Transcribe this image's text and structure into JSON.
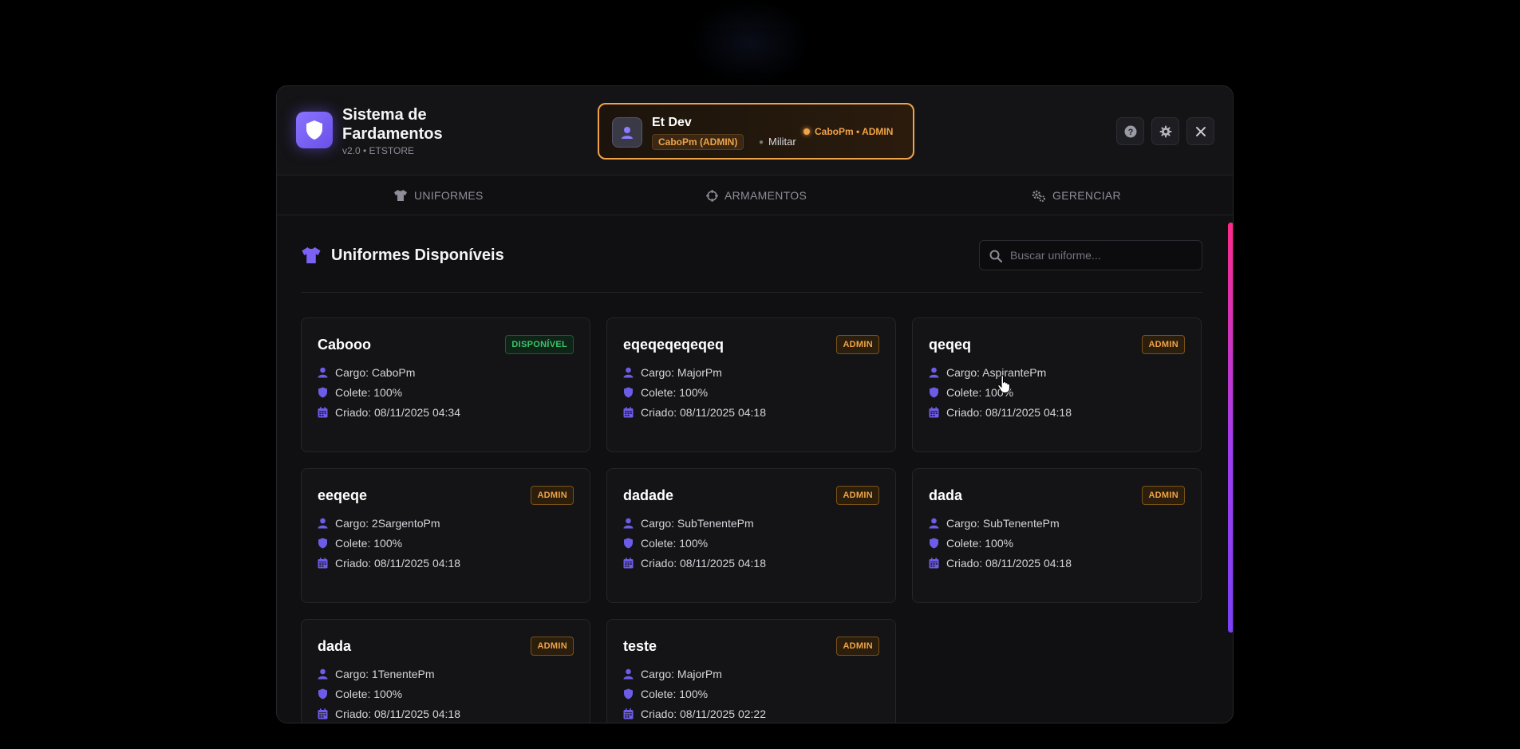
{
  "app": {
    "title": "Sistema de Fardamentos",
    "subtitle": "v2.0 • ETSTORE"
  },
  "user": {
    "name": "Et Dev",
    "rank": "CaboPm (ADMIN)",
    "role": "Militar",
    "status": "CaboPm • ADMIN"
  },
  "tabs": [
    {
      "label": "UNIFORMES",
      "icon": "shirt-icon",
      "active": true
    },
    {
      "label": "ARMAMENTOS",
      "icon": "crosshair-icon"
    },
    {
      "label": "GERENCIAR",
      "icon": "gears-icon"
    }
  ],
  "main": {
    "title": "Uniformes Disponíveis",
    "search_placeholder": "Buscar uniforme..."
  },
  "cards": [
    {
      "name": "Cabooo",
      "badge": "DISPONÍVEL",
      "badge_type": "ok",
      "cargo": "Cargo: CaboPm",
      "colete": "Colete: 100%",
      "criado": "Criado: 08/11/2025 04:34"
    },
    {
      "name": "eqeqeqeqeqeq",
      "badge": "ADMIN",
      "badge_type": "admin",
      "cargo": "Cargo: MajorPm",
      "colete": "Colete: 100%",
      "criado": "Criado: 08/11/2025 04:18"
    },
    {
      "name": "qeqeq",
      "badge": "ADMIN",
      "badge_type": "admin",
      "cargo": "Cargo: AspirantePm",
      "colete": "Colete: 100%",
      "criado": "Criado: 08/11/2025 04:18"
    },
    {
      "name": "eeqeqe",
      "badge": "ADMIN",
      "badge_type": "admin",
      "cargo": "Cargo: 2SargentoPm",
      "colete": "Colete: 100%",
      "criado": "Criado: 08/11/2025 04:18"
    },
    {
      "name": "dadade",
      "badge": "ADMIN",
      "badge_type": "admin",
      "cargo": "Cargo: SubTenentePm",
      "colete": "Colete: 100%",
      "criado": "Criado: 08/11/2025 04:18"
    },
    {
      "name": "dada",
      "badge": "ADMIN",
      "badge_type": "admin",
      "cargo": "Cargo: SubTenentePm",
      "colete": "Colete: 100%",
      "criado": "Criado: 08/11/2025 04:18"
    },
    {
      "name": "dada",
      "badge": "ADMIN",
      "badge_type": "admin",
      "cargo": "Cargo: 1TenentePm",
      "colete": "Colete: 100%",
      "criado": "Criado: 08/11/2025 04:18"
    },
    {
      "name": "teste",
      "badge": "ADMIN",
      "badge_type": "admin",
      "cargo": "Cargo: MajorPm",
      "colete": "Colete: 100%",
      "criado": "Criado: 08/11/2025 02:22"
    }
  ],
  "colors": {
    "accent": "#7b62f5",
    "admin": "#f0a347",
    "available": "#3cc46e"
  }
}
